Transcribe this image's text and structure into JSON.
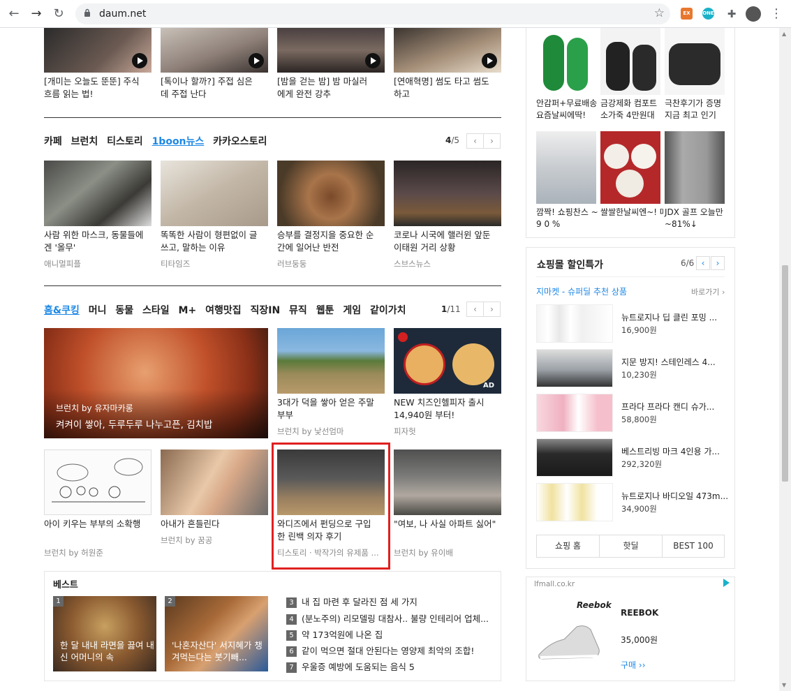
{
  "browser": {
    "url": "daum.net",
    "ext1": "EX",
    "ext2": "ONE"
  },
  "top_videos": [
    {
      "caption": "[개미는 오늘도 뚠뚠] 주식 흐름 읽는 법!"
    },
    {
      "caption": "[톡이나 할까?] 주접 심은 데 주접 난다"
    },
    {
      "caption": "[밤을 걷는 밤] 밤 마실러에게 완전 강추"
    },
    {
      "caption": "[연애혁명] 썸도 타고 썸도 하고"
    }
  ],
  "section1": {
    "tabs": [
      "카페",
      "브런치",
      "티스토리",
      "1boon뉴스",
      "카카오스토리"
    ],
    "active_tab": "1boon뉴스",
    "page_current": "4",
    "page_total": "/5",
    "items": [
      {
        "caption": "사람 위한 마스크, 동물들에겐 '올무'",
        "source": "애니멀피플"
      },
      {
        "caption": "똑똑한 사람이 형편없이 글 쓰고, 말하는 이유",
        "source": "티타임즈"
      },
      {
        "caption": "승부를 결정지을 중요한 순간에 일어난 반전",
        "source": "러브둥둥"
      },
      {
        "caption": "코로나 시국에 핼러윈 앞둔 이태원 거리 상황",
        "source": "스브스뉴스"
      }
    ]
  },
  "section2": {
    "tabs": [
      "홈&쿠킹",
      "머니",
      "동물",
      "스타일",
      "M+",
      "여행맛집",
      "직장IN",
      "뮤직",
      "웹툰",
      "게임",
      "같이가치"
    ],
    "active_tab": "홈&쿠킹",
    "page_current": "1",
    "page_total": "/11",
    "feature": {
      "source": "브런치 by 유자마카롱",
      "caption": "켜켜이 쌓아, 두루두루 나누고픈, 김치밥"
    },
    "items": [
      {
        "caption": "3대가 덕을 쌓아 얻은 주말부부",
        "source": "브런치 by 낯선엄마"
      },
      {
        "caption": "NEW 치즈인헬피자 출시 14,940원 부터!",
        "source": "피자헛",
        "badge": "AD"
      },
      {
        "caption": "아이 키우는 부부의 소확행",
        "source": "브런치 by 허원준"
      },
      {
        "caption": "아내가 흔들린다",
        "source": "브런치 by 꿈공"
      },
      {
        "caption": "와디즈에서 펀딩으로 구입한 린백 의자 후기",
        "source": "티스토리 · 박작가의 유제품 ..."
      },
      {
        "caption": "\"여보, 나 사실 아파트 싫어\"",
        "source": "브런치 by 유이배"
      }
    ]
  },
  "best": {
    "title": "베스트",
    "cards": [
      {
        "rank": "1",
        "caption": "한 달 내내 라면을 끓여 내신 어머니의 속"
      },
      {
        "rank": "2",
        "caption": "'나혼자산다' 서지혜가 챙겨먹는다는 붓기빼..."
      }
    ],
    "list": [
      {
        "rank": "3",
        "text": "내 집 마련 후 달라진 점 세 가지"
      },
      {
        "rank": "4",
        "text": "(분노주의) 리모델링 대참사.. 불량 인테리어 업체..."
      },
      {
        "rank": "5",
        "text": "약 173억원에 나온 집"
      },
      {
        "rank": "6",
        "text": "같이 먹으면 절대 안된다는 영양제 최악의 조합!"
      },
      {
        "rank": "7",
        "text": "우울증 예방에 도움되는 음식 5"
      }
    ]
  },
  "right_products": [
    {
      "caption": "안감퍼+무료배송 요즘날씨에딱!"
    },
    {
      "caption": "금강제화 컴포트 소가죽 4만원대"
    },
    {
      "caption": "극찬후기가 증명 지금 최고 인기"
    },
    {
      "caption": "깜짝! 쇼핑찬스 ~ 9 0 %"
    },
    {
      "caption": "쌀쌀한날씨엔~! 따끈따끈꼬마호빵"
    },
    {
      "caption": "JDX 골프 오늘만~81%↓"
    }
  ],
  "shopping": {
    "title": "쇼핑몰 할인특가",
    "page": "6/6",
    "sub": "지마켓 - 슈퍼딜 추천 상품",
    "more": "바로가기 ›",
    "items": [
      {
        "name": "뉴트로지나 딥 클린 포밍 ...",
        "price": "16,900원"
      },
      {
        "name": "지문 방지! 스테인레스 4...",
        "price": "10,230원"
      },
      {
        "name": "프라다 프라다 캔디 슈가...",
        "price": "58,800원"
      },
      {
        "name": "베스트리빙 마크 4인용 가...",
        "price": "292,320원"
      },
      {
        "name": "뉴트로지나 바디오일 473m...",
        "price": "34,900원"
      }
    ],
    "buttons": [
      "쇼핑 홈",
      "핫딜",
      "BEST 100"
    ]
  },
  "ad": {
    "domain": "lfmall.co.kr",
    "logo": "Reebok",
    "brand": "REEBOK",
    "price": "35,000원",
    "cta": "구매 ››"
  },
  "colors": {
    "accent": "#1e88e5",
    "highlight_box": "#e02020"
  }
}
